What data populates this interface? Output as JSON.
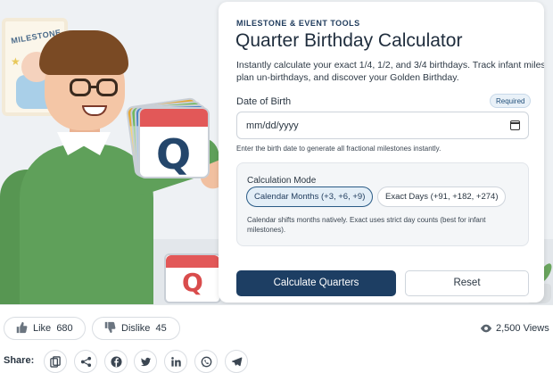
{
  "hero": {
    "frame_text": "MILESTONE",
    "calendar_letter": "Q",
    "small_calendar_letter": "Q"
  },
  "card": {
    "eyebrow": "MILESTONE & EVENT TOOLS",
    "title": "Quarter Birthday Calculator",
    "description_line1": "Instantly calculate your exact 1/4, 1/2, and 3/4 birthdays. Track infant milestone",
    "description_line2": "plan un-birthdays, and discover your Golden Birthday.",
    "dob_label": "Date of Birth",
    "required_badge": "Required",
    "date_placeholder": "mm/dd/yyyy",
    "dob_hint": "Enter the birth date to generate all fractional milestones instantly.",
    "mode_label": "Calculation Mode",
    "mode_options": [
      {
        "label": "Calendar Months (+3, +6, +9)",
        "selected": true
      },
      {
        "label": "Exact Days (+91, +182, +274)",
        "selected": false
      }
    ],
    "mode_note": "Calendar shifts months natively. Exact uses strict day counts (best for infant milestones).",
    "calculate_button": "Calculate Quarters",
    "reset_button": "Reset"
  },
  "engagement": {
    "like_label": "Like",
    "like_count": "680",
    "dislike_label": "Dislike",
    "dislike_count": "45",
    "views_text": "2,500 Views",
    "share_label": "Share:",
    "share_icons": [
      "copy-link-icon",
      "share-icon",
      "facebook-icon",
      "twitter-icon",
      "linkedin-icon",
      "whatsapp-icon",
      "telegram-icon"
    ]
  },
  "colors": {
    "primary": "#1d3e63",
    "accent": "#2a5b86",
    "shirt": "#5fa05a",
    "calendar_red": "#e25858"
  }
}
